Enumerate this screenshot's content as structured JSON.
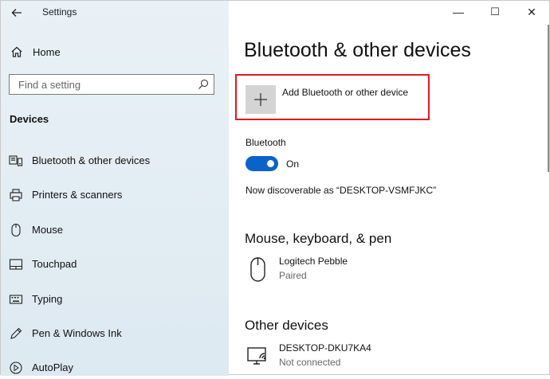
{
  "window": {
    "title": "Settings",
    "controls": {
      "minimize": "—",
      "maximize": "☐",
      "close": "✕"
    }
  },
  "sidebar": {
    "home_label": "Home",
    "search_placeholder": "Find a setting",
    "section_title": "Devices",
    "items": [
      {
        "label": "Bluetooth & other devices",
        "icon": "bluetooth-devices-icon"
      },
      {
        "label": "Printers & scanners",
        "icon": "printer-icon"
      },
      {
        "label": "Mouse",
        "icon": "mouse-icon"
      },
      {
        "label": "Touchpad",
        "icon": "touchpad-icon"
      },
      {
        "label": "Typing",
        "icon": "keyboard-icon"
      },
      {
        "label": "Pen & Windows Ink",
        "icon": "pen-icon"
      },
      {
        "label": "AutoPlay",
        "icon": "autoplay-icon"
      }
    ]
  },
  "main": {
    "title": "Bluetooth & other devices",
    "add_device_label": "Add Bluetooth or other device",
    "bluetooth": {
      "label": "Bluetooth",
      "state": "On",
      "discoverable_text": "Now discoverable as “DESKTOP-VSMFJKC”"
    },
    "mouse_section": {
      "title": "Mouse, keyboard, & pen",
      "devices": [
        {
          "name": "Logitech Pebble",
          "status": "Paired"
        }
      ]
    },
    "other_section": {
      "title": "Other devices",
      "devices": [
        {
          "name": "DESKTOP-DKU7KA4",
          "status": "Not connected"
        }
      ]
    }
  },
  "colors": {
    "accent": "#0a63c9",
    "highlight_border": "#e0191f",
    "sidebar_bg": "#e3edf4"
  }
}
